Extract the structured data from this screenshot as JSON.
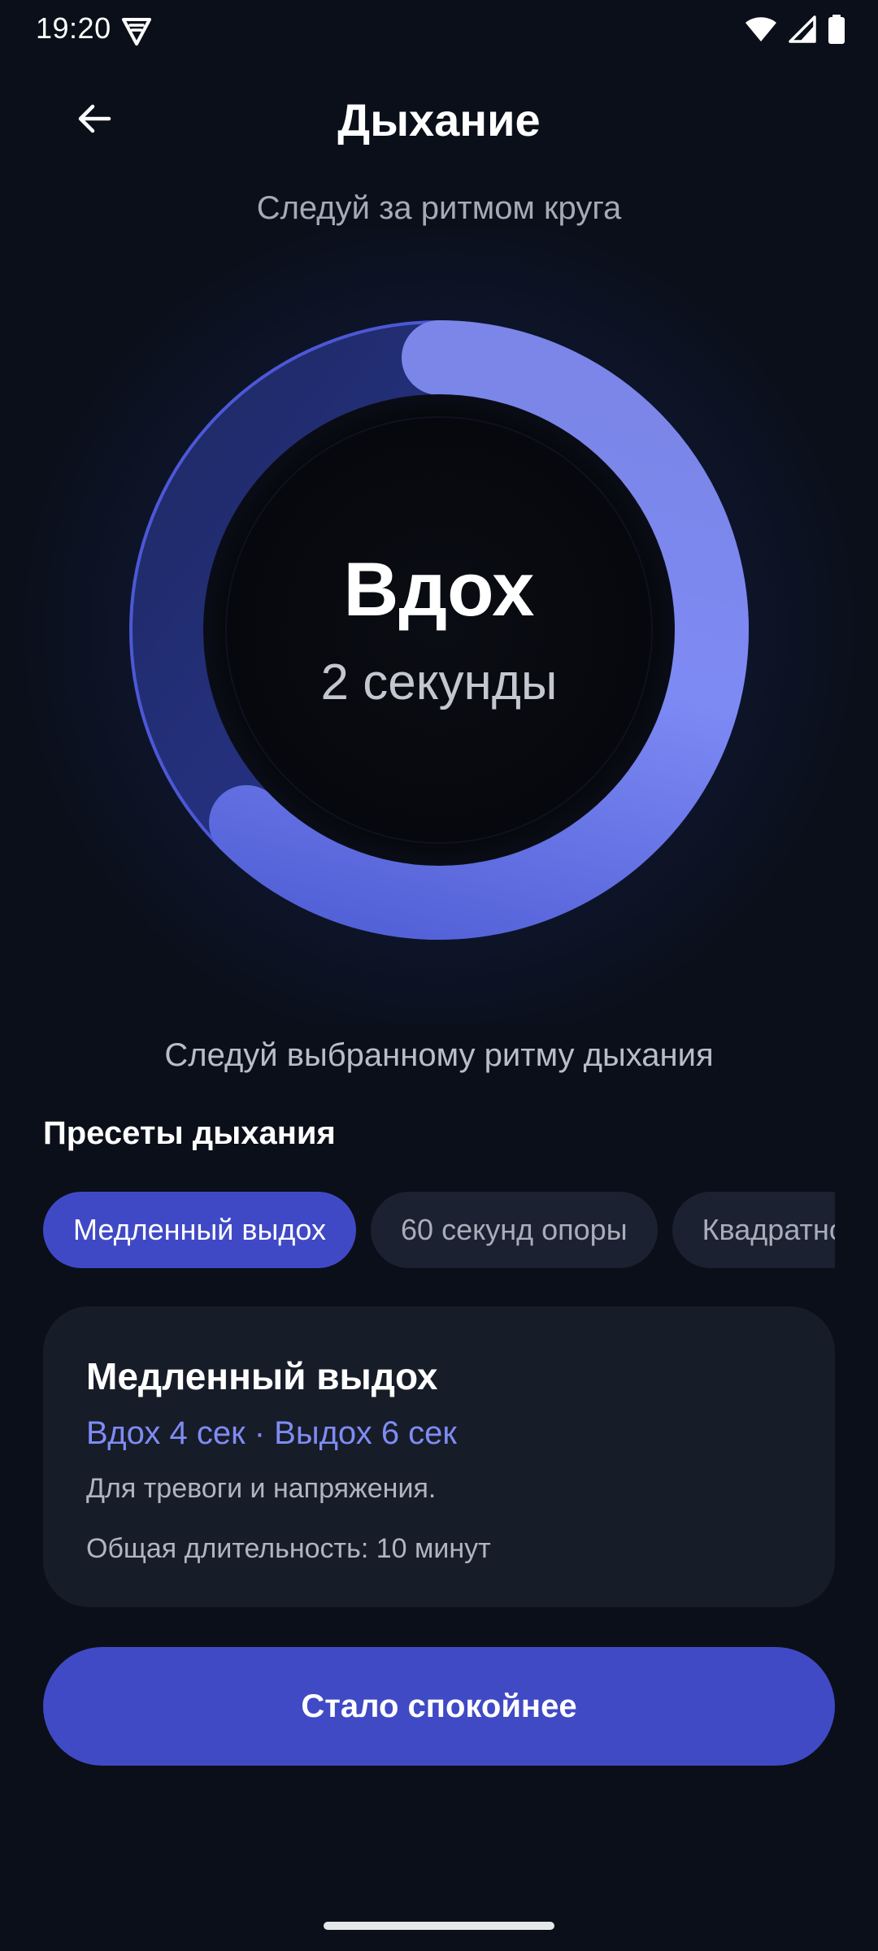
{
  "status_bar": {
    "time": "19:20",
    "icons": [
      "vpn-shield-icon",
      "wifi-icon",
      "signal-icon",
      "battery-icon"
    ]
  },
  "header": {
    "title": "Дыхание",
    "back_icon": "arrow-left-icon"
  },
  "subtitle": "Следуй за ритмом круга",
  "breathing": {
    "phase": "Вдох",
    "duration_text": "2 секунды",
    "progress": 0.625
  },
  "hint": "Следуй выбранному ритму дыхания",
  "presets": {
    "title": "Пресеты дыхания",
    "items": [
      {
        "label": "Медленный выдох",
        "active": true
      },
      {
        "label": "60 секунд опоры",
        "active": false
      },
      {
        "label": "Квадратное дыхание",
        "active": false
      }
    ]
  },
  "selected_preset": {
    "title": "Медленный выдох",
    "rhythm": "Вдох 4 сек · Выдох 6 сек",
    "description": "Для тревоги и напряжения.",
    "total_duration": "Общая длительность: 10 минут"
  },
  "primary_button": {
    "label": "Стало спокойнее"
  },
  "colors": {
    "background": "#0a0f19",
    "accent": "#4049c5",
    "accent_light": "#7f8cf3",
    "card": "#171c29",
    "chip_inactive": "#1b2130"
  }
}
